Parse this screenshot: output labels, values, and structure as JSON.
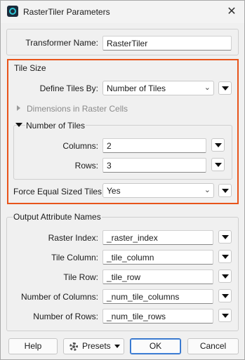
{
  "window": {
    "title": "RasterTiler Parameters",
    "close_glyph": "✕"
  },
  "transformer": {
    "label": "Transformer Name:",
    "value": "RasterTiler"
  },
  "tile_size": {
    "title": "Tile Size",
    "define_label": "Define Tiles By:",
    "define_value": "Number of Tiles",
    "dimensions_label": "Dimensions in Raster Cells",
    "number_section": {
      "title": "Number of Tiles",
      "columns_label": "Columns:",
      "columns_value": "2",
      "rows_label": "Rows:",
      "rows_value": "3"
    },
    "force_label": "Force Equal Sized Tiles:",
    "force_value": "Yes"
  },
  "output": {
    "title": "Output Attribute Names",
    "raster_index_label": "Raster Index:",
    "raster_index_value": "_raster_index",
    "tile_column_label": "Tile Column:",
    "tile_column_value": "_tile_column",
    "tile_row_label": "Tile Row:",
    "tile_row_value": "_tile_row",
    "num_columns_label": "Number of Columns:",
    "num_columns_value": "_num_tile_columns",
    "num_rows_label": "Number of Rows:",
    "num_rows_value": "_num_tile_rows"
  },
  "footer": {
    "help": "Help",
    "presets": "Presets",
    "ok": "OK",
    "cancel": "Cancel"
  },
  "colors": {
    "highlight": "#e8541b",
    "primary_border": "#2b6cc4"
  }
}
